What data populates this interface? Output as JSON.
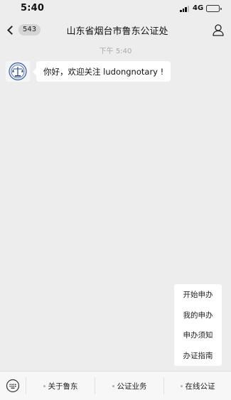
{
  "status_bar": {
    "time": "5:40",
    "network": "4G",
    "battery_level": 0.75,
    "signal_bars": 3
  },
  "nav": {
    "back_icon": "chevron-left-icon",
    "unread_count": "543",
    "title": "山东省烟台市鲁东公证处",
    "profile_icon": "person-icon"
  },
  "chat": {
    "timestamp": "下午 5:40",
    "avatar_icon": "notary-seal-icon",
    "message": "你好，欢迎关注 ludongnotary !"
  },
  "submenu": {
    "items": [
      "开始申办",
      "我的申办",
      "申办须知",
      "办证指南"
    ]
  },
  "menu_bar": {
    "keyboard_icon": "keyboard-icon",
    "items": [
      "关于鲁东",
      "公证业务",
      "在线公证"
    ]
  },
  "colors": {
    "background": "#ededed",
    "bubble": "#ffffff",
    "menu_bar": "#f7f7f7"
  }
}
